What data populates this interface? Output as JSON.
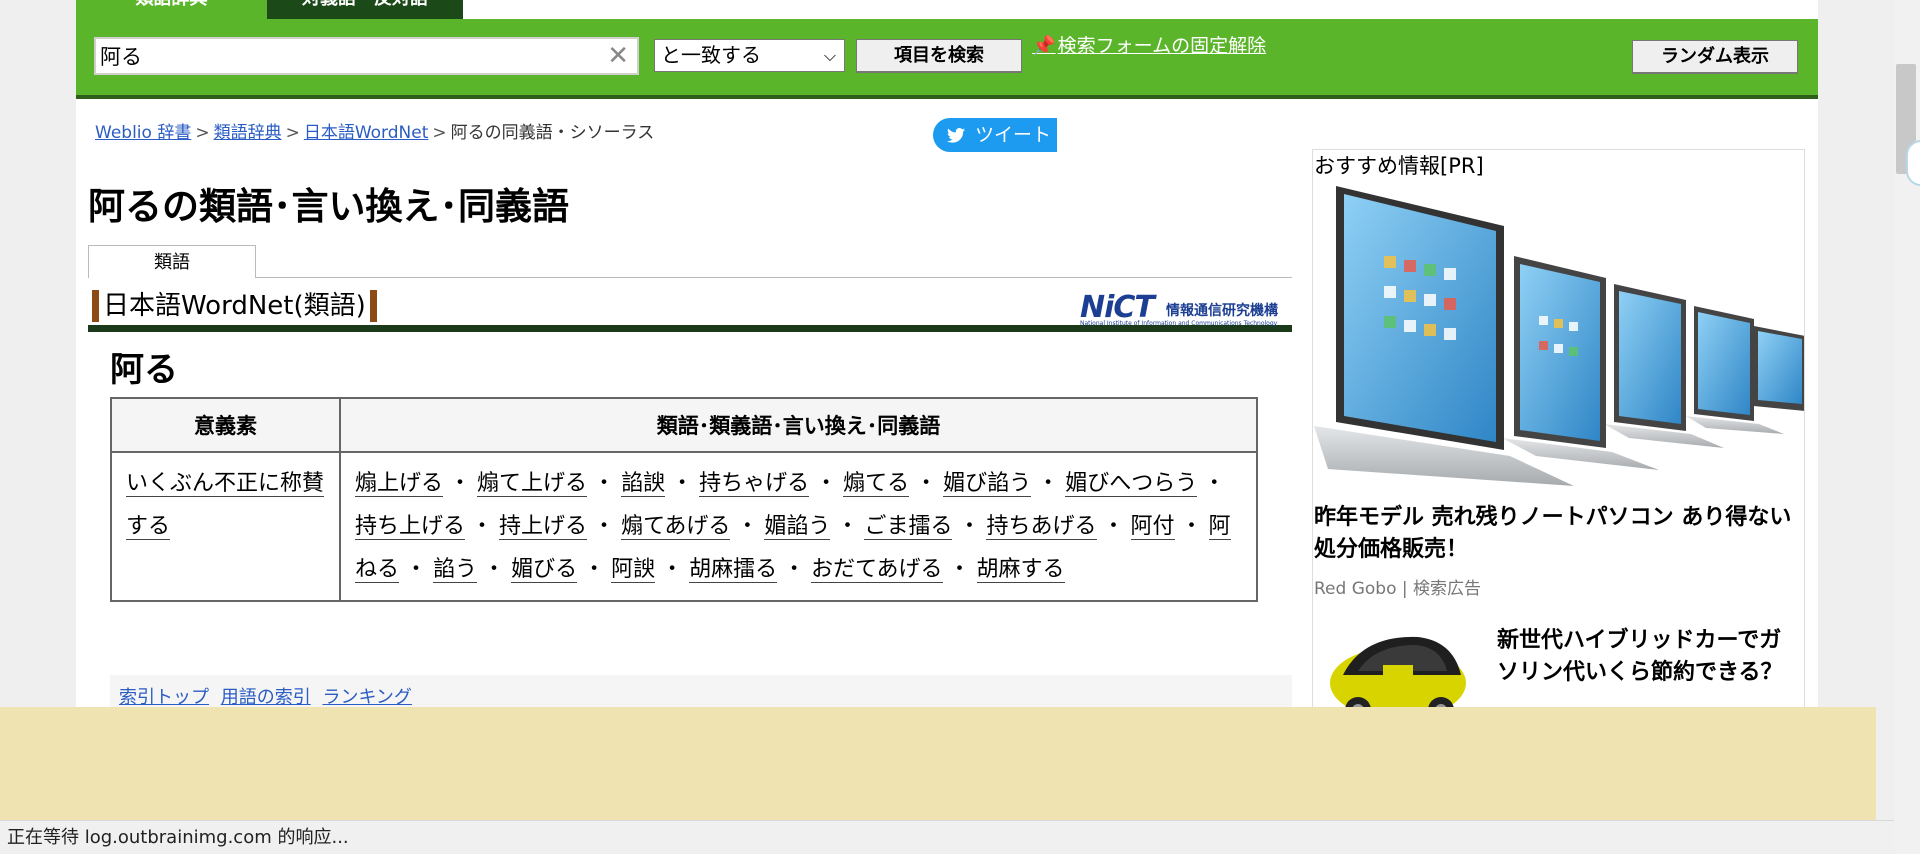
{
  "top_tabs": [
    "類語辞典",
    "対義語・反対語"
  ],
  "search": {
    "value": "阿る",
    "clear_glyph": "✕",
    "match_mode": "と一致する",
    "search_button": "項目を検索",
    "pin_link": "検索フォームの固定解除",
    "random_button": "ランダム表示"
  },
  "breadcrumb": {
    "items": [
      "Weblio 辞書",
      "類語辞典",
      "日本語WordNet"
    ],
    "current": "阿るの同義語・シソーラス",
    "separator": ">"
  },
  "tweet_button": "ツイート",
  "page_title": "阿るの類語･言い換え･同義語",
  "tabs": [
    "類語"
  ],
  "section": {
    "title": "日本語WordNet(類語)",
    "logo_main": "NiCT",
    "logo_jp": "情報通信研究機構",
    "logo_small": "National Institute of Information and Communications Technology"
  },
  "entry": {
    "word": "阿る",
    "table": {
      "headers": [
        "意義素",
        "類語･類義語･言い換え･同義語"
      ],
      "rows": [
        {
          "sense": "いくぶん不正に称賛する",
          "synonyms": [
            "煽上げる",
            "煽て上げる",
            "諂諛",
            "持ちゃげる",
            "煽てる",
            "媚び諂う",
            "媚びへつらう",
            "持ち上げる",
            "持上げる",
            "煽てあげる",
            "媚諂う",
            "ごま擂る",
            "持ちあげる",
            "阿付",
            "阿ねる",
            "諂う",
            "媚びる",
            "阿諛",
            "胡麻擂る",
            "おだてあげる",
            "胡麻する"
          ]
        }
      ]
    },
    "separator": "・"
  },
  "index_links": [
    "索引トップ",
    "用語の索引",
    "ランキング"
  ],
  "ad": {
    "label": "おすすめ情報[PR]",
    "ad1_title": "昨年モデル 売れ残りノートパソコン あり得ない処分価格販売！",
    "ad1_source": "Red Gobo | 検索広告",
    "ad2_title": "新世代ハイブリッドカーでガソリン代いくら節約できる？"
  },
  "status_bar": "正在等待 log.outbrainimg.com 的响应...",
  "colors": {
    "search_bar": "#5bb52a",
    "link": "#2a5cc4",
    "overlay": "#efe3b2",
    "tweet": "#1d9bf0"
  },
  "icons": [
    "clear-icon",
    "chevron-down-icon",
    "pin-icon",
    "twitter-bird-icon"
  ]
}
